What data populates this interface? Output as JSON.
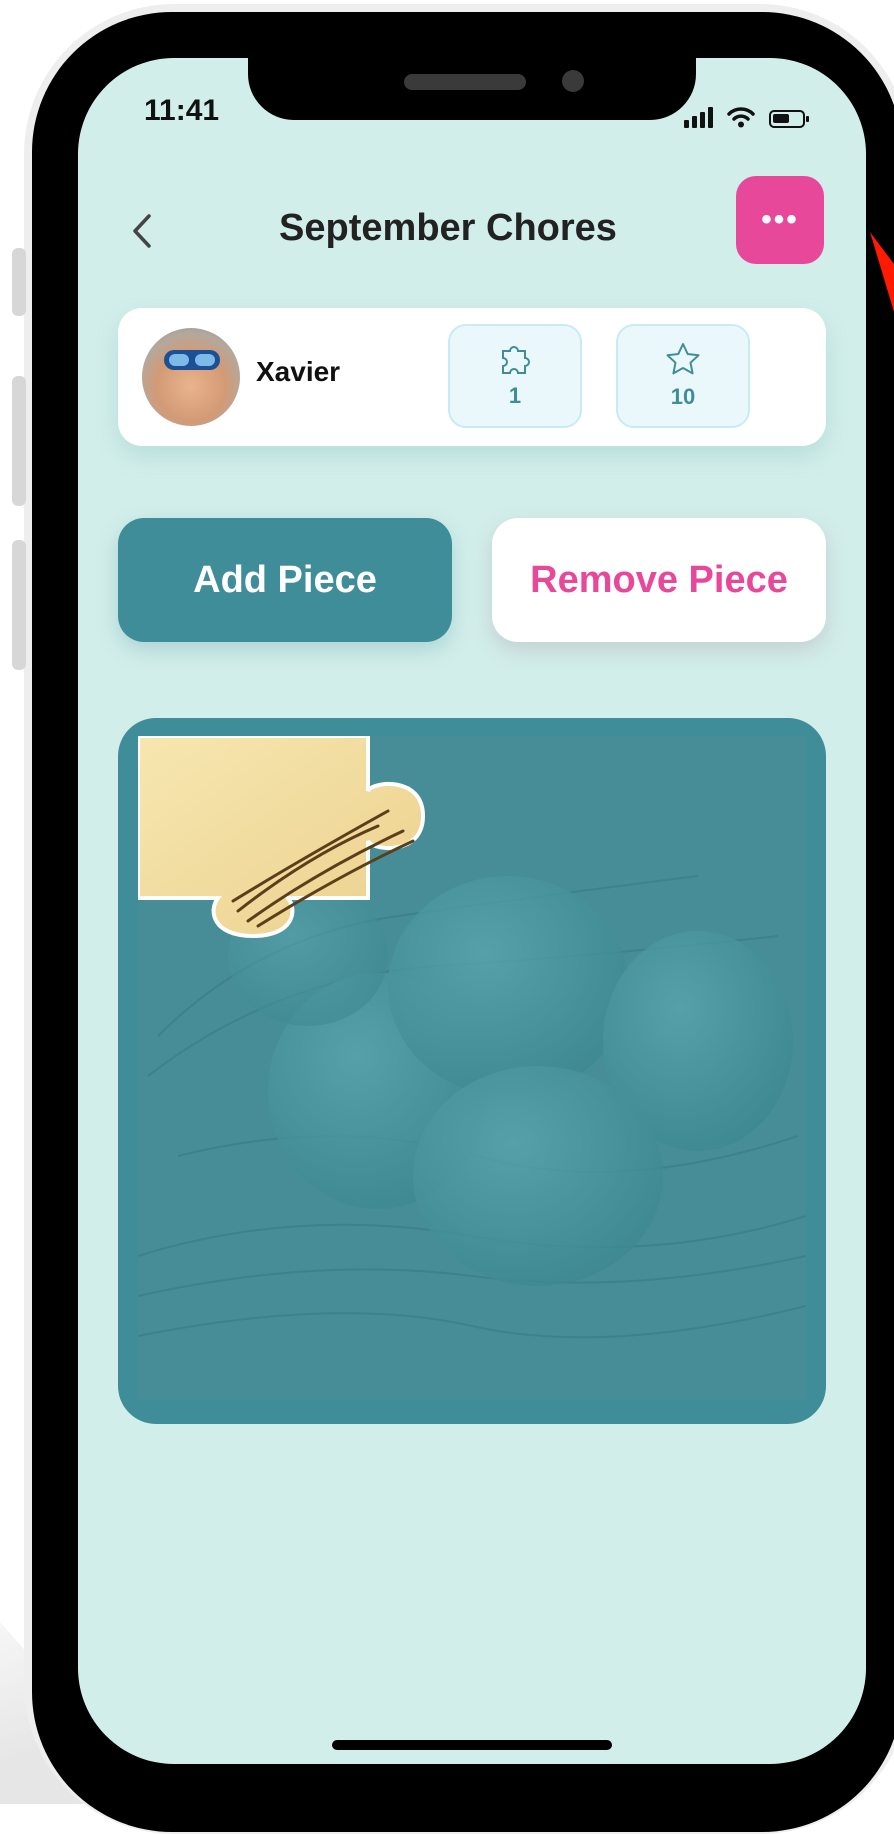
{
  "status_bar": {
    "time": "11:41"
  },
  "header": {
    "title": "September Chores",
    "more_label": "•••"
  },
  "user_card": {
    "name": "Xavier",
    "stats": [
      {
        "icon": "puzzle-icon",
        "value": "1"
      },
      {
        "icon": "star-icon",
        "value": "10"
      }
    ]
  },
  "actions": {
    "add_label": "Add Piece",
    "remove_label": "Remove Piece"
  },
  "colors": {
    "teal": "#3f8d99",
    "pink": "#e8489a",
    "background": "#d2eeea"
  }
}
